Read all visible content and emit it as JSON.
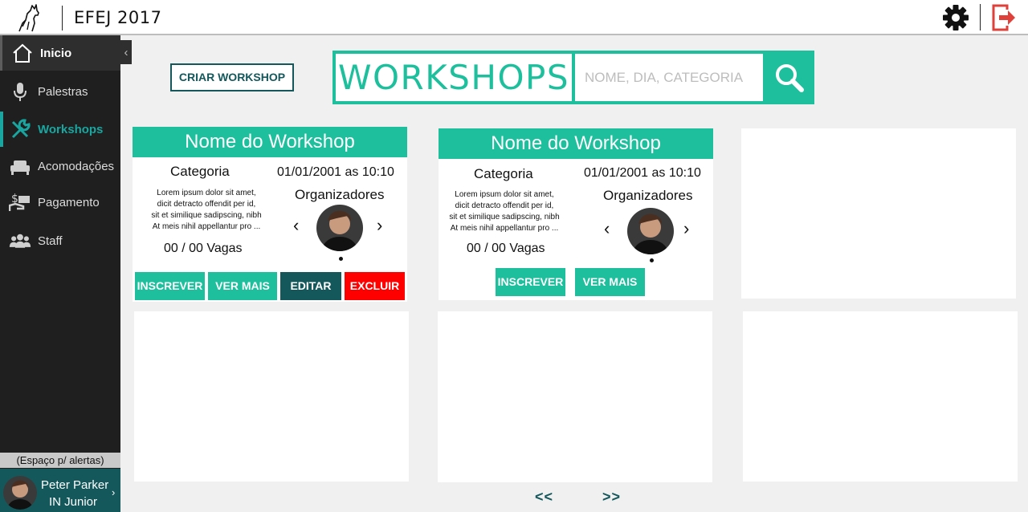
{
  "header": {
    "app_title": "EFEJ 2017"
  },
  "sidebar": {
    "items": [
      {
        "label": "Inicio"
      },
      {
        "label": "Palestras"
      },
      {
        "label": "Workshops"
      },
      {
        "label": "Acomodações"
      },
      {
        "label": "Pagamento"
      },
      {
        "label": "Staff"
      }
    ],
    "alerts_text": "(Espaço p/ alertas)",
    "user": {
      "name": "Peter Parker",
      "org": "IN Junior"
    }
  },
  "main": {
    "create_button": "CRIAR WORKSHOP",
    "search_title": "WORKSHOPS",
    "search_placeholder": "NOME, DIA, CATEGORIA"
  },
  "cards": [
    {
      "title": "Nome do Workshop",
      "category": "Categoria",
      "datetime": "01/01/2001 as 10:10",
      "desc_lines": [
        "Lorem ipsum dolor sit amet,",
        "dicit detracto offendit per id,",
        "sit et similique sadipscing, nibh",
        "At meis nihil appellantur pro ..."
      ],
      "organizers_label": "Organizadores",
      "vagas": "00 / 00 Vagas",
      "buttons": {
        "subscribe": "INSCREVER",
        "more": "VER MAIS",
        "edit": "EDITAR",
        "delete": "EXCLUIR"
      }
    },
    {
      "title": "Nome do Workshop",
      "category": "Categoria",
      "datetime": "01/01/2001 as 10:10",
      "desc_lines": [
        "Lorem ipsum dolor sit amet,",
        "dicit detracto offendit per id,",
        "sit et similique sadipscing, nibh",
        "At meis nihil appellantur pro ..."
      ],
      "organizers_label": "Organizadores",
      "vagas": "00 / 00 Vagas",
      "buttons": {
        "subscribe": "INSCREVER",
        "more": "VER MAIS"
      }
    }
  ],
  "pagination": {
    "prev": "<<",
    "next": ">>"
  },
  "colors": {
    "accent": "#1dbf9c",
    "dark_teal": "#14585c",
    "danger": "#ff0000",
    "sidebar_bg": "#1f1f1f"
  },
  "icons": [
    "wolf-logo-icon",
    "gear-icon",
    "logout-icon",
    "home-icon",
    "microphone-icon",
    "wrench-icon",
    "bed-icon",
    "payment-icon",
    "people-icon",
    "search-icon"
  ]
}
